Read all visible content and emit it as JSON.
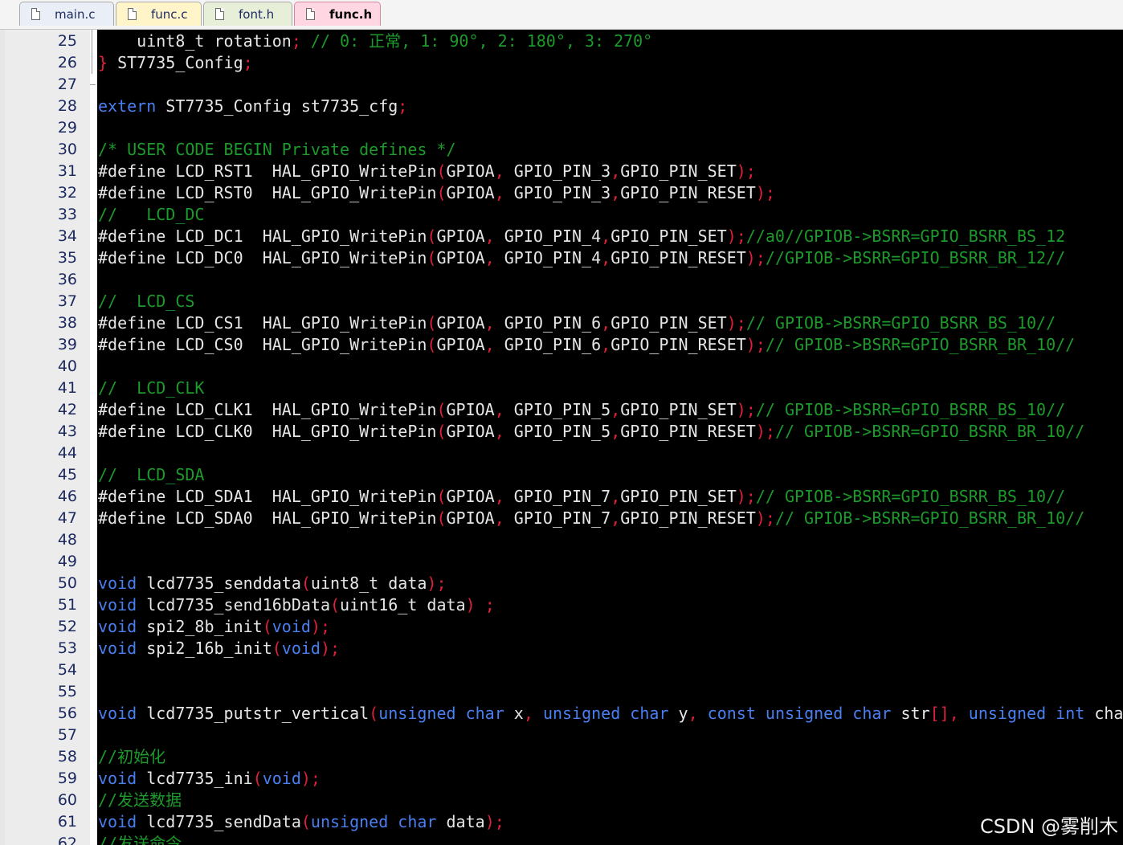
{
  "tabs": [
    {
      "label": "main.c",
      "active": false,
      "bg": "#e9eef7"
    },
    {
      "label": "func.c",
      "active": false,
      "bg": "#fff5c8"
    },
    {
      "label": "font.h",
      "active": false,
      "bg": "#e8efd8"
    },
    {
      "label": "func.h",
      "active": true,
      "bg": "#ffd6e2"
    }
  ],
  "colors": {
    "keyword": "#4a7ff0",
    "comment": "#1c9a2b",
    "punctuation": "#e0203a",
    "text": "#e6e6e6",
    "background": "#000000",
    "gutter": "#ececec",
    "line_number": "#1d2a60"
  },
  "current_line": 56,
  "lines": [
    {
      "n": "25",
      "tokens": [
        [
          "plain",
          "    uint8_t rotation"
        ],
        [
          "punct",
          ";"
        ],
        [
          "cmt",
          " // 0: 正常, 1: 90°, 2: 180°, 3: 270°"
        ]
      ]
    },
    {
      "n": "26",
      "tokens": [
        [
          "punct",
          "}"
        ],
        [
          "plain",
          " ST7735_Config"
        ],
        [
          "punct",
          ";"
        ]
      ]
    },
    {
      "n": "27",
      "tokens": []
    },
    {
      "n": "28",
      "tokens": [
        [
          "kw",
          "extern"
        ],
        [
          "plain",
          " ST7735_Config st7735_cfg"
        ],
        [
          "punct",
          ";"
        ]
      ]
    },
    {
      "n": "29",
      "tokens": []
    },
    {
      "n": "30",
      "tokens": [
        [
          "cmt",
          "/* USER CODE BEGIN Private defines */"
        ]
      ]
    },
    {
      "n": "31",
      "tokens": [
        [
          "pp",
          "#define"
        ],
        [
          "plain",
          " LCD_RST1  HAL_GPIO_WritePin"
        ],
        [
          "punct",
          "("
        ],
        [
          "plain",
          "GPIOA"
        ],
        [
          "punct",
          ","
        ],
        [
          "plain",
          " GPIO_PIN_3"
        ],
        [
          "punct",
          ","
        ],
        [
          "plain",
          "GPIO_PIN_SET"
        ],
        [
          "punct",
          ");"
        ]
      ]
    },
    {
      "n": "32",
      "tokens": [
        [
          "pp",
          "#define"
        ],
        [
          "plain",
          " LCD_RST0  HAL_GPIO_WritePin"
        ],
        [
          "punct",
          "("
        ],
        [
          "plain",
          "GPIOA"
        ],
        [
          "punct",
          ","
        ],
        [
          "plain",
          " GPIO_PIN_3"
        ],
        [
          "punct",
          ","
        ],
        [
          "plain",
          "GPIO_PIN_RESET"
        ],
        [
          "punct",
          ");"
        ]
      ]
    },
    {
      "n": "33",
      "tokens": [
        [
          "cmt",
          "//   LCD_DC"
        ]
      ]
    },
    {
      "n": "34",
      "tokens": [
        [
          "pp",
          "#define"
        ],
        [
          "plain",
          " LCD_DC1  HAL_GPIO_WritePin"
        ],
        [
          "punct",
          "("
        ],
        [
          "plain",
          "GPIOA"
        ],
        [
          "punct",
          ","
        ],
        [
          "plain",
          " GPIO_PIN_4"
        ],
        [
          "punct",
          ","
        ],
        [
          "plain",
          "GPIO_PIN_SET"
        ],
        [
          "punct",
          ");"
        ],
        [
          "cmt",
          "//a0//GPIOB->BSRR=GPIO_BSRR_BS_12"
        ]
      ]
    },
    {
      "n": "35",
      "tokens": [
        [
          "pp",
          "#define"
        ],
        [
          "plain",
          " LCD_DC0  HAL_GPIO_WritePin"
        ],
        [
          "punct",
          "("
        ],
        [
          "plain",
          "GPIOA"
        ],
        [
          "punct",
          ","
        ],
        [
          "plain",
          " GPIO_PIN_4"
        ],
        [
          "punct",
          ","
        ],
        [
          "plain",
          "GPIO_PIN_RESET"
        ],
        [
          "punct",
          ");"
        ],
        [
          "cmt",
          "//GPIOB->BSRR=GPIO_BSRR_BR_12//"
        ]
      ]
    },
    {
      "n": "36",
      "tokens": []
    },
    {
      "n": "37",
      "tokens": [
        [
          "cmt",
          "//  LCD_CS"
        ]
      ]
    },
    {
      "n": "38",
      "tokens": [
        [
          "pp",
          "#define"
        ],
        [
          "plain",
          " LCD_CS1  HAL_GPIO_WritePin"
        ],
        [
          "punct",
          "("
        ],
        [
          "plain",
          "GPIOA"
        ],
        [
          "punct",
          ","
        ],
        [
          "plain",
          " GPIO_PIN_6"
        ],
        [
          "punct",
          ","
        ],
        [
          "plain",
          "GPIO_PIN_SET"
        ],
        [
          "punct",
          ");"
        ],
        [
          "cmt",
          "// GPIOB->BSRR=GPIO_BSRR_BS_10//"
        ]
      ]
    },
    {
      "n": "39",
      "tokens": [
        [
          "pp",
          "#define"
        ],
        [
          "plain",
          " LCD_CS0  HAL_GPIO_WritePin"
        ],
        [
          "punct",
          "("
        ],
        [
          "plain",
          "GPIOA"
        ],
        [
          "punct",
          ","
        ],
        [
          "plain",
          " GPIO_PIN_6"
        ],
        [
          "punct",
          ","
        ],
        [
          "plain",
          "GPIO_PIN_RESET"
        ],
        [
          "punct",
          ");"
        ],
        [
          "cmt",
          "// GPIOB->BSRR=GPIO_BSRR_BR_10//"
        ]
      ]
    },
    {
      "n": "40",
      "tokens": []
    },
    {
      "n": "41",
      "tokens": [
        [
          "cmt",
          "//  LCD_CLK"
        ]
      ]
    },
    {
      "n": "42",
      "tokens": [
        [
          "pp",
          "#define"
        ],
        [
          "plain",
          " LCD_CLK1  HAL_GPIO_WritePin"
        ],
        [
          "punct",
          "("
        ],
        [
          "plain",
          "GPIOA"
        ],
        [
          "punct",
          ","
        ],
        [
          "plain",
          " GPIO_PIN_5"
        ],
        [
          "punct",
          ","
        ],
        [
          "plain",
          "GPIO_PIN_SET"
        ],
        [
          "punct",
          ");"
        ],
        [
          "cmt",
          "// GPIOB->BSRR=GPIO_BSRR_BS_10//"
        ]
      ]
    },
    {
      "n": "43",
      "tokens": [
        [
          "pp",
          "#define"
        ],
        [
          "plain",
          " LCD_CLK0  HAL_GPIO_WritePin"
        ],
        [
          "punct",
          "("
        ],
        [
          "plain",
          "GPIOA"
        ],
        [
          "punct",
          ","
        ],
        [
          "plain",
          " GPIO_PIN_5"
        ],
        [
          "punct",
          ","
        ],
        [
          "plain",
          "GPIO_PIN_RESET"
        ],
        [
          "punct",
          ");"
        ],
        [
          "cmt",
          "// GPIOB->BSRR=GPIO_BSRR_BR_10//"
        ]
      ]
    },
    {
      "n": "44",
      "tokens": []
    },
    {
      "n": "45",
      "tokens": [
        [
          "cmt",
          "//  LCD_SDA"
        ]
      ]
    },
    {
      "n": "46",
      "tokens": [
        [
          "pp",
          "#define"
        ],
        [
          "plain",
          " LCD_SDA1  HAL_GPIO_WritePin"
        ],
        [
          "punct",
          "("
        ],
        [
          "plain",
          "GPIOA"
        ],
        [
          "punct",
          ","
        ],
        [
          "plain",
          " GPIO_PIN_7"
        ],
        [
          "punct",
          ","
        ],
        [
          "plain",
          "GPIO_PIN_SET"
        ],
        [
          "punct",
          ");"
        ],
        [
          "cmt",
          "// GPIOB->BSRR=GPIO_BSRR_BS_10//"
        ]
      ]
    },
    {
      "n": "47",
      "tokens": [
        [
          "pp",
          "#define"
        ],
        [
          "plain",
          " LCD_SDA0  HAL_GPIO_WritePin"
        ],
        [
          "punct",
          "("
        ],
        [
          "plain",
          "GPIOA"
        ],
        [
          "punct",
          ","
        ],
        [
          "plain",
          " GPIO_PIN_7"
        ],
        [
          "punct",
          ","
        ],
        [
          "plain",
          "GPIO_PIN_RESET"
        ],
        [
          "punct",
          ");"
        ],
        [
          "cmt",
          "// GPIOB->BSRR=GPIO_BSRR_BR_10//"
        ]
      ]
    },
    {
      "n": "48",
      "tokens": []
    },
    {
      "n": "49",
      "tokens": []
    },
    {
      "n": "50",
      "tokens": [
        [
          "kw",
          "void"
        ],
        [
          "plain",
          " lcd7735_senddata"
        ],
        [
          "punct",
          "("
        ],
        [
          "plain",
          "uint8_t data"
        ],
        [
          "punct",
          ");"
        ]
      ]
    },
    {
      "n": "51",
      "tokens": [
        [
          "kw",
          "void"
        ],
        [
          "plain",
          " lcd7735_send16bData"
        ],
        [
          "punct",
          "("
        ],
        [
          "plain",
          "uint16_t data"
        ],
        [
          "punct",
          ")"
        ],
        [
          "plain",
          " "
        ],
        [
          "punct",
          ";"
        ]
      ]
    },
    {
      "n": "52",
      "tokens": [
        [
          "kw",
          "void"
        ],
        [
          "plain",
          " spi2_8b_init"
        ],
        [
          "punct",
          "("
        ],
        [
          "kw",
          "void"
        ],
        [
          "punct",
          ");"
        ]
      ]
    },
    {
      "n": "53",
      "tokens": [
        [
          "kw",
          "void"
        ],
        [
          "plain",
          " spi2_16b_init"
        ],
        [
          "punct",
          "("
        ],
        [
          "kw",
          "void"
        ],
        [
          "punct",
          ");"
        ]
      ]
    },
    {
      "n": "54",
      "tokens": []
    },
    {
      "n": "55",
      "tokens": []
    },
    {
      "n": "56",
      "tokens": [
        [
          "kw",
          "void"
        ],
        [
          "plain",
          " lcd7735_putstr_vertical"
        ],
        [
          "punct",
          "("
        ],
        [
          "kw",
          "unsigned char"
        ],
        [
          "plain",
          " x"
        ],
        [
          "punct",
          ","
        ],
        [
          "plain",
          " "
        ],
        [
          "kw",
          "unsigned char"
        ],
        [
          "plain",
          " y"
        ],
        [
          "punct",
          ","
        ],
        [
          "plain",
          " "
        ],
        [
          "kw",
          "const unsigned char"
        ],
        [
          "plain",
          " str"
        ],
        [
          "punct",
          "[],"
        ],
        [
          "plain",
          " "
        ],
        [
          "kw",
          "unsigned int"
        ],
        [
          "plain",
          " char"
        ]
      ]
    },
    {
      "n": "57",
      "tokens": []
    },
    {
      "n": "58",
      "tokens": [
        [
          "cmt",
          "//初始化"
        ]
      ]
    },
    {
      "n": "59",
      "tokens": [
        [
          "kw",
          "void"
        ],
        [
          "plain",
          " lcd7735_ini"
        ],
        [
          "punct",
          "("
        ],
        [
          "kw",
          "void"
        ],
        [
          "punct",
          ");"
        ]
      ]
    },
    {
      "n": "60",
      "tokens": [
        [
          "cmt",
          "//发送数据"
        ]
      ]
    },
    {
      "n": "61",
      "tokens": [
        [
          "kw",
          "void"
        ],
        [
          "plain",
          " lcd7735_sendData"
        ],
        [
          "punct",
          "("
        ],
        [
          "kw",
          "unsigned char"
        ],
        [
          "plain",
          " data"
        ],
        [
          "punct",
          ");"
        ]
      ]
    },
    {
      "n": "62",
      "tokens": [
        [
          "cmt",
          "//发送命令"
        ]
      ]
    }
  ],
  "watermark": "CSDN @雾削木"
}
